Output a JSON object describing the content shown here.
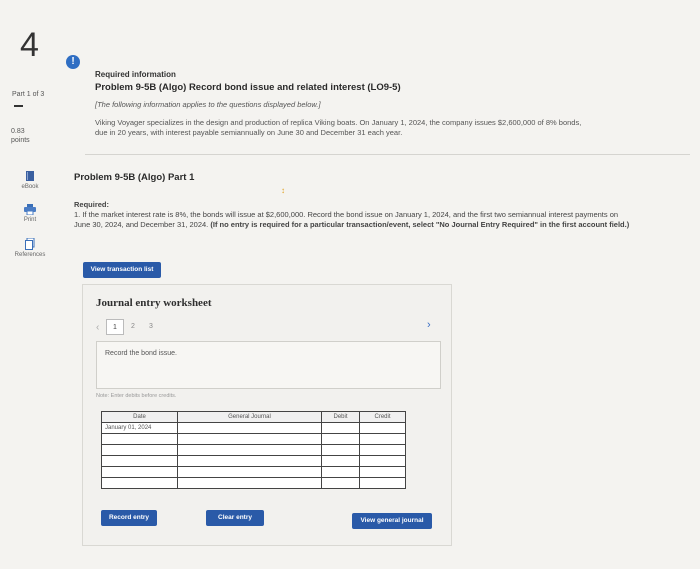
{
  "sidebar": {
    "question_number": "4",
    "part_label": "Part 1 of 3",
    "points_value": "0.83",
    "points_label": "points",
    "tools": [
      {
        "label": "eBook",
        "icon": "book-icon"
      },
      {
        "label": "Print",
        "icon": "print-icon"
      },
      {
        "label": "References",
        "icon": "references-icon"
      }
    ]
  },
  "required_info": {
    "heading": "Required information",
    "problem_title": "Problem 9-5B (Algo) Record bond issue and related interest (LO9-5)",
    "note": "[The following information applies to the questions displayed below.]",
    "body": "Viking Voyager specializes in the design and production of replica Viking boats. On January 1, 2024, the company issues $2,600,000 of 8% bonds, due in 20 years, with interest payable semiannually on June 30 and December 31 each year."
  },
  "part": {
    "title": "Problem 9-5B (Algo) Part 1",
    "required_label": "Required:",
    "required_text": "1. If the market interest rate is 8%, the bonds will issue at $2,600,000. Record the bond issue on January 1, 2024, and the first two semiannual interest payments on June 30, 2024, and December 31, 2024.",
    "required_bold": "(If no entry is required for a particular transaction/event, select \"No Journal Entry Required\" in the first account field.)"
  },
  "buttons": {
    "view_transaction_list": "View transaction list",
    "record_entry": "Record entry",
    "clear_entry": "Clear entry",
    "view_general_journal": "View general journal"
  },
  "worksheet": {
    "title": "Journal entry worksheet",
    "pages": [
      "1",
      "2",
      "3"
    ],
    "active_page": "1",
    "description": "Record the bond issue.",
    "note": "Note: Enter debits before credits.",
    "columns": [
      "Date",
      "General Journal",
      "Debit",
      "Credit"
    ],
    "rows": [
      {
        "date": "January 01, 2024",
        "account": "",
        "debit": "",
        "credit": ""
      },
      {
        "date": "",
        "account": "",
        "debit": "",
        "credit": ""
      },
      {
        "date": "",
        "account": "",
        "debit": "",
        "credit": ""
      },
      {
        "date": "",
        "account": "",
        "debit": "",
        "credit": ""
      },
      {
        "date": "",
        "account": "",
        "debit": "",
        "credit": ""
      },
      {
        "date": "",
        "account": "",
        "debit": "",
        "credit": ""
      }
    ]
  },
  "colors": {
    "accent": "#2a5aa8",
    "alert": "#2f6ec3",
    "background": "#f4f3f0"
  }
}
